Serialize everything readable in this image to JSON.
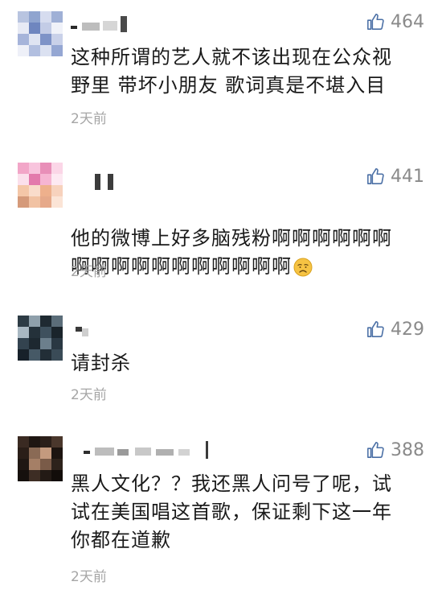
{
  "comments": [
    {
      "likes": "464",
      "text": "这种所谓的艺人就不该出现在公众视\n野里 带坏小朋友 歌词真是不堪入目",
      "time": "2天前"
    },
    {
      "likes": "441",
      "text": "他的微博上好多脑残粉啊啊啊啊啊啊\n啊啊啊啊啊啊啊啊啊啊啊",
      "emoji": "disappointed-face",
      "time": "2天前"
    },
    {
      "likes": "429",
      "text": "请封杀",
      "time": "2天前"
    },
    {
      "likes": "388",
      "text": "黑人文化？？我还黑人问号了呢，试\n试在美国唱这首歌，保证剩下这一年\n你都在道歉",
      "time": "2天前"
    }
  ],
  "icons": {
    "like": "thumbs-up-icon"
  },
  "colors": {
    "like_icon": "#4a6fa5",
    "like_count": "#8a8a8a",
    "timestamp": "#a6a6a6",
    "text": "#1a1a1a"
  }
}
